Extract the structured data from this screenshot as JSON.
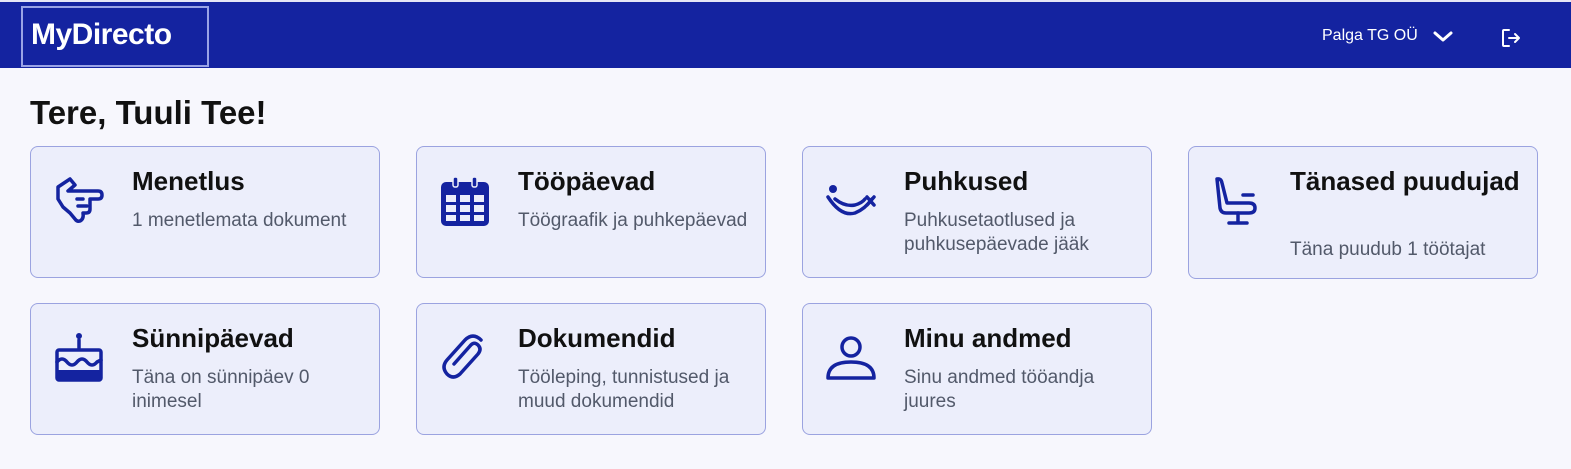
{
  "header": {
    "logo_text": "MyDirecto",
    "company": "Palga TG OÜ",
    "colors": {
      "bar": "#1423a0",
      "accent": "#1423a0",
      "card_bg": "#eceefb",
      "card_border": "#9ba3e0"
    },
    "icons": {
      "dropdown": "chevron-down-icon",
      "logout": "logout-icon"
    }
  },
  "greeting": "Tere, Tuuli Tee!",
  "cards": [
    {
      "title": "Menetlus",
      "desc": "1 menetlemata dokument",
      "icon": "hand-pointing-icon"
    },
    {
      "title": "Tööpäevad",
      "desc": "Töögraafik ja puhkepäevad",
      "icon": "calendar-icon"
    },
    {
      "title": "Puhkused",
      "desc": "Puhkusetaotlused ja puhkusepäevade jääk",
      "icon": "hammock-icon"
    },
    {
      "title": "Tänased puudujad",
      "desc": "Täna puudub 1 töötajat",
      "icon": "chair-icon"
    },
    {
      "title": "Sünnipäevad",
      "desc": "Täna on sünnipäev 0 inimesel",
      "icon": "birthday-cake-icon"
    },
    {
      "title": "Dokumendid",
      "desc": "Tööleping, tunnistused ja muud dokumendid",
      "icon": "paperclip-icon"
    },
    {
      "title": "Minu andmed",
      "desc": "Sinu andmed tööandja juures",
      "icon": "user-icon"
    }
  ]
}
